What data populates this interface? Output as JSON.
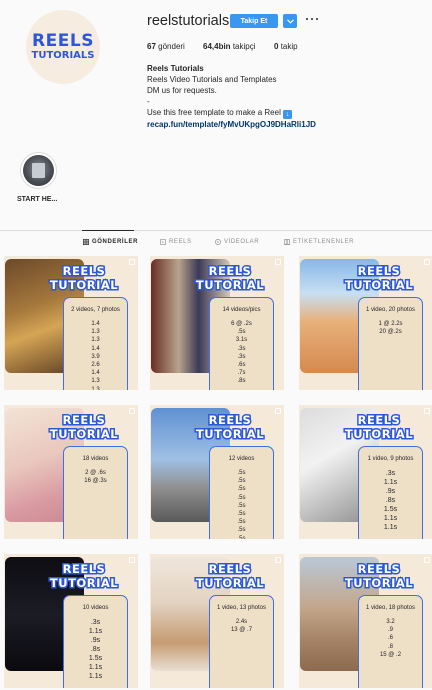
{
  "profile": {
    "avatar_line1": "REELS",
    "avatar_line2": "TUTORIALS",
    "username": "reelstutorials",
    "follow_label": "Takip Et",
    "stats": [
      {
        "value": "67",
        "label": "gönderi"
      },
      {
        "value": "64,4bin",
        "label": "takipçi"
      },
      {
        "value": "0",
        "label": "takip"
      }
    ],
    "bio": {
      "name": "Reels Tutorials",
      "line1": "Reels Video Tutorials and Templates",
      "line2": "DM us for requests.",
      "line3": "-",
      "line4": "Use this free template to make a Reel",
      "link": "recap.fun/template/fyMvUKpgOJ9DHaRli1JD"
    }
  },
  "highlights": [
    {
      "label": "START HE..."
    }
  ],
  "tabs": [
    {
      "label": "GÖNDERİLER",
      "active": true,
      "icon": "grid-icon"
    },
    {
      "label": "REELS",
      "active": false,
      "icon": "reels-icon"
    },
    {
      "label": "VİDEOLAR",
      "active": false,
      "icon": "video-icon"
    },
    {
      "label": "ETİKETLENENLER",
      "active": false,
      "icon": "tagged-icon"
    }
  ],
  "posts": [
    {
      "title": "REELS TUTORIAL",
      "caption": "2 videos, 7 photos",
      "items": [
        "1.4",
        "1.3",
        "1.3",
        "1.4",
        "3.9",
        "2.6",
        "1.4",
        "1.3",
        "1.3"
      ]
    },
    {
      "title": "REELS TUTORIAL",
      "caption": "14 videos/pics",
      "items": [
        "6 @ .2s",
        ".5s",
        "3.1s",
        ".3s",
        ".3s",
        ".6s",
        ".7s",
        ".8s",
        "."
      ]
    },
    {
      "title": "REELS TUTORIAL",
      "caption": "1 video, 20 photos",
      "items": [
        "1 @ 2.2s",
        "20 @.2s"
      ]
    },
    {
      "title": "REELS TUTORIAL",
      "caption": "18 videos",
      "items": [
        "2 @ .6s",
        "16 @.3s"
      ]
    },
    {
      "title": "REELS TUTORIAL",
      "caption": "12 videos",
      "items": [
        ".5s",
        ".5s",
        ".5s",
        ".5s",
        ".5s",
        ".5s",
        ".5s",
        ".5s",
        ".5s"
      ]
    },
    {
      "title": "REELS TUTORIAL",
      "caption": "1 video, 9 photos",
      "items": [
        ".3s",
        "1.1s",
        ".9s",
        ".8s",
        "1.5s",
        "1.1s",
        "1.1s"
      ]
    },
    {
      "title": "REELS TUTORIAL",
      "caption": "10 videos",
      "items": [
        ".3s",
        "1.1s",
        ".9s",
        ".8s",
        "1.5s",
        "1.1s",
        "1.1s"
      ]
    },
    {
      "title": "REELS TUTORIAL",
      "caption": "1 video, 13 photos",
      "items": [
        "2.4s",
        "13 @ .7"
      ]
    },
    {
      "title": "REELS TUTORIAL",
      "caption": "1 video, 18 photos",
      "items": [
        "3.2",
        ".9",
        ".6",
        ".8",
        "15 @ .2"
      ]
    }
  ],
  "colors": {
    "accent": "#3897f0",
    "brand_blue": "#2c58d8",
    "card_bg": "#f5ead9"
  }
}
